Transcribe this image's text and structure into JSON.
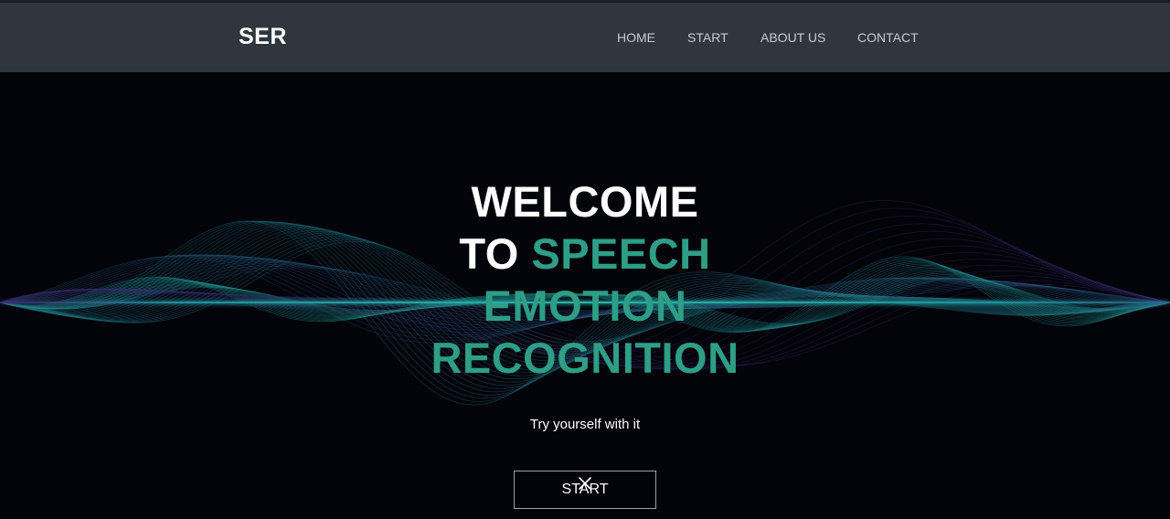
{
  "navbar": {
    "brand": "SER",
    "links": [
      {
        "label": "HOME"
      },
      {
        "label": "START"
      },
      {
        "label": "ABOUT US"
      },
      {
        "label": "CONTACT"
      }
    ]
  },
  "hero": {
    "line1": "WELCOME",
    "line2_white": "TO",
    "line2_teal": "SPEECH",
    "line3": "EMOTION",
    "line4": "RECOGNITION",
    "tagline": "Try yourself with it",
    "button_label": "START"
  },
  "colors": {
    "navbar_bg": "#2f363d",
    "hero_bg": "#03030a",
    "accent_teal": "#2e9e86"
  },
  "icons": {
    "cursor": "x-cursor-icon",
    "background": "sound-wave-graphic"
  }
}
